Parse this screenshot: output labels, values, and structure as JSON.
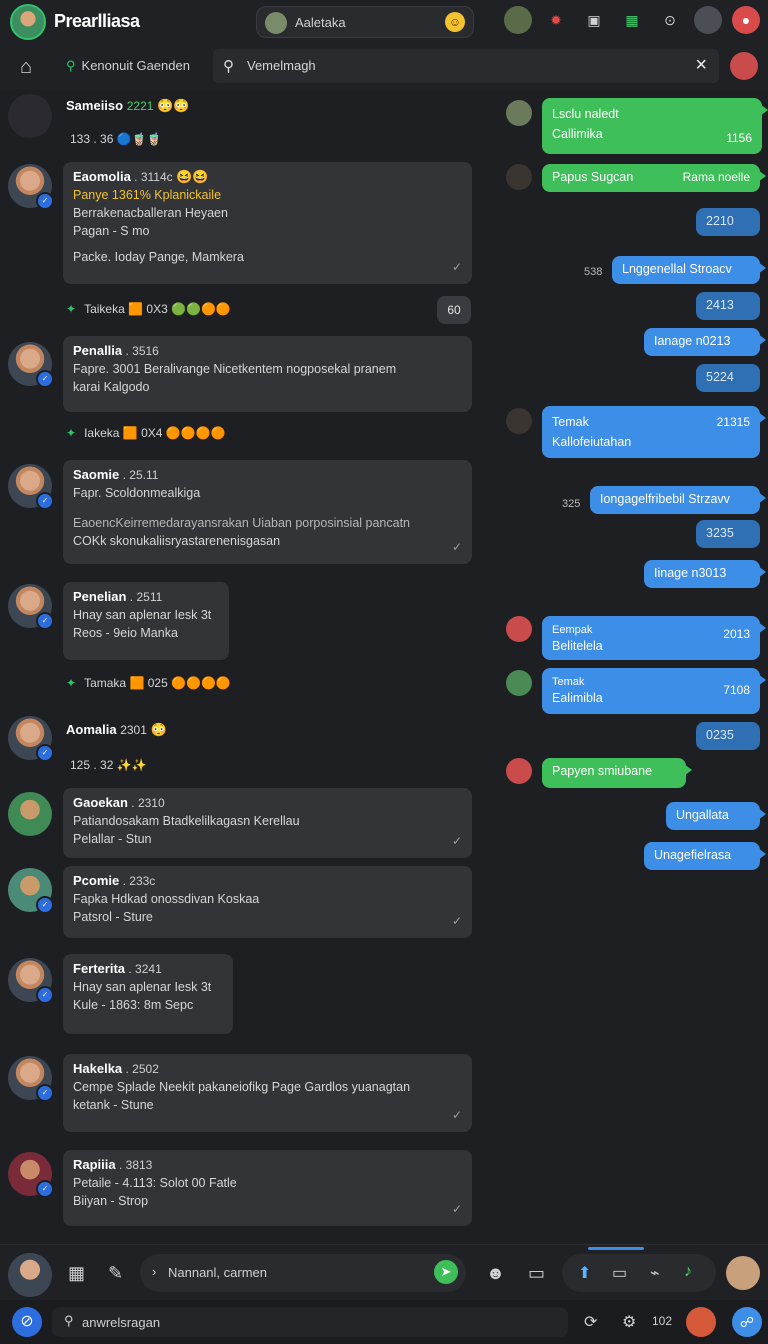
{
  "app": {
    "title": "Prearlliasa"
  },
  "top_search": {
    "value": "Aaletaka"
  },
  "subbar": {
    "section_label": "Kenonuit Gaenden",
    "search_value": "Vemelmagh"
  },
  "left_messages": [
    {
      "type": "plain",
      "name": "Sameiiso",
      "meta": "2221",
      "sub": "133 . 36"
    },
    {
      "type": "card",
      "name": "Eaomolia",
      "meta": "3114c",
      "lines": [
        "Panye 1361% Kplanickaile",
        "Berrakenacballeran Heyaen",
        "Pagan - S mo",
        "Packe. Ioday Pange, Mamkera"
      ]
    },
    {
      "type": "reaction",
      "label": "Taikeka",
      "count": "0X3",
      "pill": "60"
    },
    {
      "type": "card",
      "name": "Penallia",
      "meta": "3516",
      "lines": [
        "Fapre. 3001 Beralivange Nicetkentem nogposekal pranem",
        "karai Kalgodo"
      ]
    },
    {
      "type": "reaction",
      "label": "Iakeka",
      "count": "0X4"
    },
    {
      "type": "card",
      "name": "Saomie",
      "meta": "25.11",
      "lines": [
        "Fapr. Scoldonmealkiga",
        "EaoencKeirremedarayansrakan Uiaban porposinsial pancatn",
        "COKk skonukaliisryastarenenisgasan"
      ]
    },
    {
      "type": "card",
      "name": "Penelian",
      "meta": "2511",
      "lines": [
        "Hnay san aplenar Iesk 3t",
        "Reos - 9eio Manka"
      ]
    },
    {
      "type": "reaction",
      "label": "Tamaka",
      "count": "025"
    },
    {
      "type": "plain",
      "name": "Aomalia",
      "meta": "2301",
      "sub": "125 . 32"
    },
    {
      "type": "card",
      "name": "Gaoekan",
      "meta": "2310",
      "lines": [
        "Patiandosakam Btadkelilkagasn Kerellau",
        "Pelallar - Stun"
      ]
    },
    {
      "type": "card",
      "name": "Pcomie",
      "meta": "233c",
      "lines": [
        "Fapka Hdkad onossdivan Koskaa",
        "Patsrol - Sture"
      ]
    },
    {
      "type": "card",
      "name": "Ferterita",
      "meta": "3241",
      "lines": [
        "Hnay san aplenar Iesk 3t",
        "Kule - 1863: 8m Sepc"
      ]
    },
    {
      "type": "card",
      "name": "Hakelka",
      "meta": "2502",
      "lines": [
        "Cempe Splade Neekit pakaneiofikg Page Gardlos yuanagtan",
        "ketank - Stune"
      ]
    },
    {
      "type": "card",
      "name": "Rapiiia",
      "meta": "3813",
      "lines": [
        "Petaile - 4.113: Solot 00 Fatle",
        "Biiyan - Strop"
      ]
    }
  ],
  "right_messages": [
    {
      "style": "green",
      "title": "Lsclu naledt",
      "text": "Callimika",
      "time": "1156"
    },
    {
      "style": "green",
      "text": "Papus Sugcan",
      "time": "Rama noelle"
    },
    {
      "style": "dim",
      "text": "2210"
    },
    {
      "style": "blue",
      "stamp": "538",
      "text": "Lnggenellal Stroacv"
    },
    {
      "style": "dim",
      "text": "2413"
    },
    {
      "style": "blue",
      "text": "Ianage n0213"
    },
    {
      "style": "dim",
      "text": "5224"
    },
    {
      "style": "blue",
      "title": "Temak",
      "text": "Kallofeiutahan",
      "time": "21315"
    },
    {
      "style": "blue",
      "stamp": "325",
      "text": "Iongagelfribebil Strzavv"
    },
    {
      "style": "dim",
      "text": "3235"
    },
    {
      "style": "blue",
      "text": "Iinage n3013"
    },
    {
      "style": "blue",
      "title": "Eempak",
      "text": "Belitelela",
      "time": "2013"
    },
    {
      "style": "blue",
      "title": "Temak",
      "text": "Ealimibla",
      "time": "7108"
    },
    {
      "style": "dim",
      "text": "0235"
    },
    {
      "style": "green",
      "text": "Papyen smiubane"
    },
    {
      "style": "blue",
      "text": "Ungallata"
    },
    {
      "style": "blue",
      "text": "Unagefielrasa"
    }
  ],
  "composer": {
    "placeholder": "Nannanl, carmen"
  },
  "statusbar": {
    "search_value": "anwrelsragan",
    "count": "102"
  },
  "colors": {
    "accent_green": "#3fbf5a",
    "accent_blue": "#3d8ee6",
    "background": "#1e1f22"
  }
}
